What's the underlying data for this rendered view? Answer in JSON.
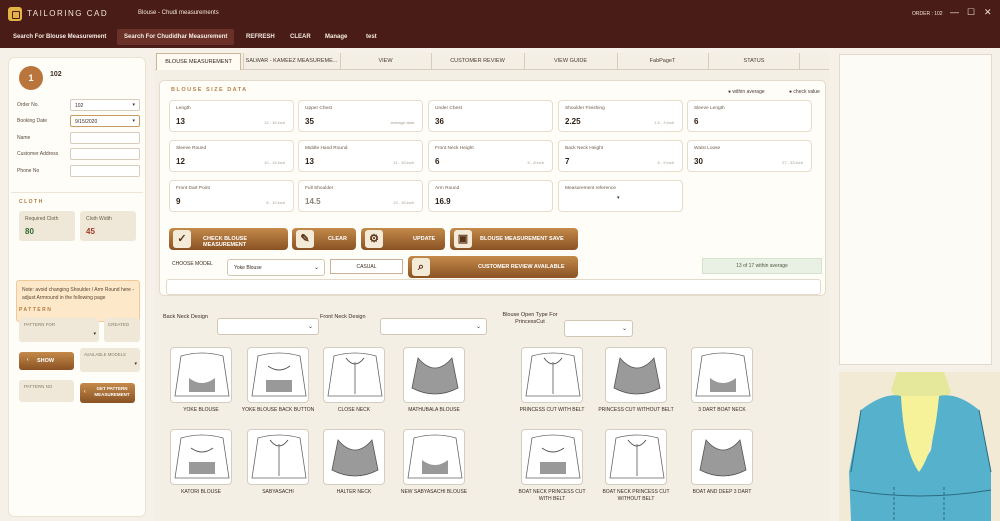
{
  "titlebar": {
    "app_name": "TAILORING CAD",
    "window_title": "Blouse - Chudi measurements",
    "order_label": "ORDER : 102",
    "minimize": "—",
    "maximize": "☐",
    "close": "✕"
  },
  "menu": [
    "Search For Blouse Measurement",
    "Search For Chudidhar Measurement",
    "REFRESH",
    "CLEAR",
    "Manage",
    "test"
  ],
  "left": {
    "avatar_number": "1",
    "customer_id": "102",
    "order_no_label": "Order No.",
    "order_no_value": "102",
    "booking_date_label": "Booking Date",
    "booking_date_value": "9/15/2020",
    "name_label": "Name",
    "address_label": "Customer Address",
    "phone_label": "Phone No",
    "cloth_title": "CLOTH",
    "required_cloth_label": "Required Cloth",
    "required_cloth_value": "80",
    "cloth_width_label": "Cloth Width",
    "cloth_width_value": "45",
    "note": "Note: avoid changing Shoulder / Arm Round here - adjust Armround in the following page",
    "pattern_title": "PATTERN",
    "pattern_for_label": "PATTERN FOR",
    "created_label": "CREATED",
    "show_label": "SHOW",
    "available_model_label": "AVAILABLE MODELS",
    "pattern_no_label": "PATTERN NO",
    "get_pattern_label": "GET PATTERN MEASUREMENT"
  },
  "tabs": [
    "BLOUSE MEASUREMENT",
    "SALWAR - KAMEEZ MEASUREME...",
    "VIEW",
    "CUSTOMER REVIEW",
    "VIEW GUIDE",
    "FabPageT",
    "STATUS"
  ],
  "blouse": {
    "title": "BLOUSE SIZE DATA",
    "legend_within": "● within average",
    "legend_check": "● check value",
    "measurements": [
      {
        "label": "Length",
        "value": "13",
        "hint": "12 - 16 inch"
      },
      {
        "label": "Upper Chest",
        "value": "35",
        "hint": "average data"
      },
      {
        "label": "Under Chest",
        "value": "36",
        "hint": ""
      },
      {
        "label": "Shoulder Finishing",
        "value": "2.25",
        "hint": "1.5 - 3 inch"
      },
      {
        "label": "Sleeve Length",
        "value": "6",
        "hint": ""
      },
      {
        "label": "Sleeve Round",
        "value": "12",
        "hint": "10 - 14 inch"
      },
      {
        "label": "Middle Hand Round",
        "value": "13",
        "hint": "11 - 15 inch"
      },
      {
        "label": "Front Neck Height",
        "value": "6",
        "hint": "5 - 8 inch"
      },
      {
        "label": "Back Neck Height",
        "value": "7",
        "hint": "6 - 9 inch"
      },
      {
        "label": "Waist Loose",
        "value": "30",
        "hint": "27 - 33 inch"
      },
      {
        "label": "Front Dart Point",
        "value": "9",
        "hint": "8 - 10 inch"
      },
      {
        "label": "Full Shoulder",
        "value": "14.5",
        "hint": "13 - 16 inch"
      },
      {
        "label": "Arm Round",
        "value": "16.9",
        "hint": ""
      },
      {
        "label": "Measurement reference",
        "value": "",
        "hint": ""
      }
    ],
    "check_btn": "CHECK BLOUSE MEASUREMENT",
    "clear_btn": "CLEAR",
    "update_btn": "UPDATE",
    "save_btn": "BLOUSE MEASUREMENT SAVE",
    "within_text": "13 of 17 within average",
    "choose_model_label": "CHOOSE MODEL",
    "model_value": "Yoke Blouse",
    "casual_label": "CASUAL",
    "review_btn": "CUSTOMER REVIEW AVAILABLE"
  },
  "designs": {
    "back_neck_label": "Back Neck Design",
    "front_neck_label": "Front Neck Design",
    "open_type_label": "Blouse Open Type For PrincessCut",
    "left_items": [
      "YOKE BLOUSE",
      "YOKE BLOUSE BACK BUTTON",
      "CLOSE NECK",
      "MATHUBALA BLOUSE",
      "KATORI BLOUSE",
      "SABYASACHI",
      "HALTER NECK",
      "NEW SABYASACHI BLOUSE"
    ],
    "right_items": [
      "PRINCESS CUT WITH BELT",
      "PRINCESS CUT WITHOUT BELT",
      "3 DART BOAT NECK",
      "BOAT NECK PRINCESS CUT WITH BELT",
      "BOAT NECK PRINCESS CUT WITHOUT BELT",
      "BOAT AND DEEP 3 DART"
    ]
  }
}
